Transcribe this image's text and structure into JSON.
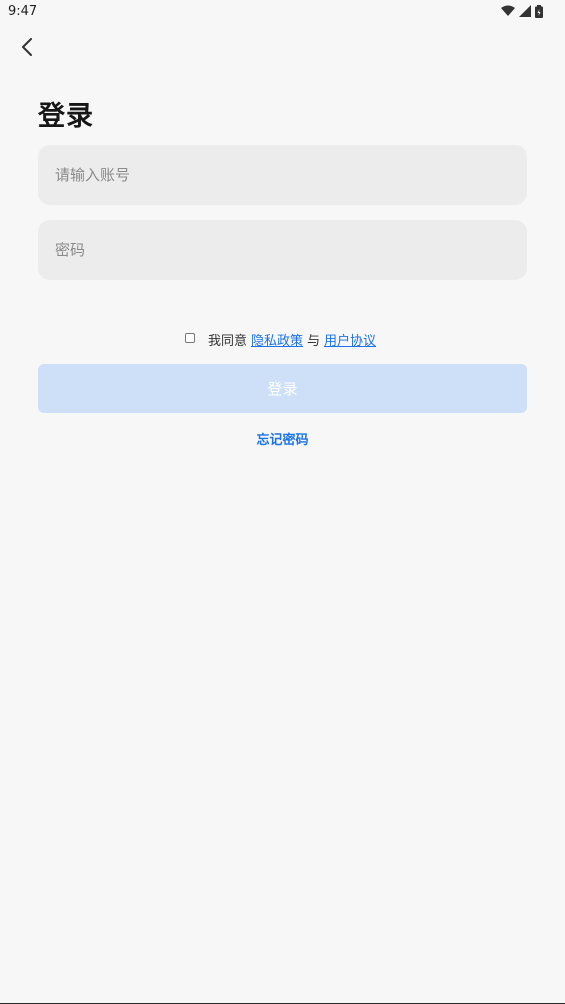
{
  "status_bar": {
    "time": "9:47",
    "icons": [
      "wifi-icon",
      "signal-icon",
      "battery-icon"
    ]
  },
  "header": {
    "back_icon": "chevron-left-icon",
    "title": "登录"
  },
  "form": {
    "account_placeholder": "请输入账号",
    "account_value": "",
    "password_placeholder": "密码",
    "password_value": ""
  },
  "agreement": {
    "checked": false,
    "prefix": "我同意",
    "privacy_link": "隐私政策",
    "conjunction": "与",
    "terms_link": "用户协议"
  },
  "actions": {
    "login_label": "登录",
    "forgot_label": "忘记密码"
  },
  "colors": {
    "background": "#f7f7f7",
    "input_bg": "#ececec",
    "button_disabled": "#cde0f7",
    "link": "#1a73e8"
  }
}
